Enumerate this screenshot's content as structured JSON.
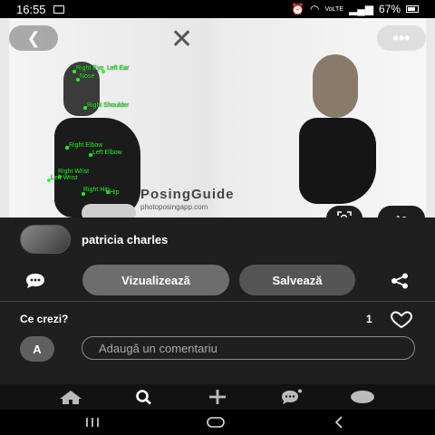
{
  "status_bar": {
    "time": "16:55",
    "network": "VoLTE",
    "battery": "67%"
  },
  "photo": {
    "back_icon": "chevron-left-icon",
    "more_icon": "dots-icon",
    "pose_labels": [
      "Right Eye",
      "Left Ear",
      "Nose",
      "Right Shoulder",
      "Right Elbow",
      "Left Elbow",
      "Left Wrist",
      "Right Wrist",
      "Right Hip",
      "Hip"
    ],
    "watermark_brand": "PosingGuide",
    "watermark_site": "photoposingapp.com"
  },
  "profile": {
    "name": "patricia charles"
  },
  "actions": {
    "view_label": "Vizualizează",
    "save_label": "Salvează"
  },
  "comments": {
    "title": "Ce crezi?",
    "like_count": "1",
    "avatar_initial": "A",
    "placeholder": "Adaugă un comentariu"
  },
  "bottom_nav": {
    "items": [
      "home-icon",
      "search-icon",
      "plus-icon",
      "chat-icon",
      "profile-icon"
    ]
  },
  "colors": {
    "background": "#1f1f1f",
    "pose_green": "#22ff22",
    "pill_view": "#6d6d6d",
    "pill_save": "#555555"
  }
}
